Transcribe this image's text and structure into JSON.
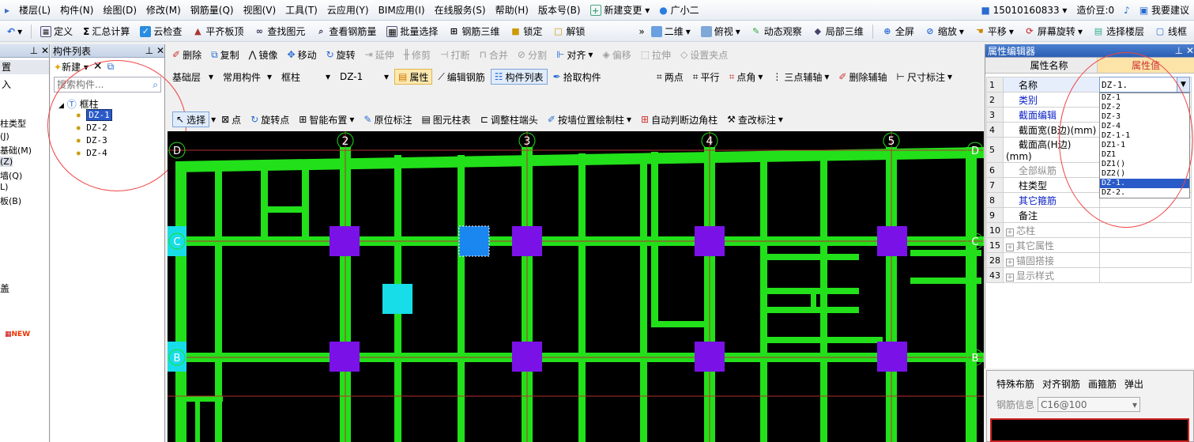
{
  "menu": [
    "楼层(L)",
    "构件(N)",
    "绘图(D)",
    "修改(M)",
    "钢筋量(Q)",
    "视图(V)",
    "工具(T)",
    "云应用(Y)",
    "BIM应用(I)",
    "在线服务(S)",
    "帮助(H)",
    "版本号(B)",
    "新建变更",
    "广小二"
  ],
  "account": {
    "phone": "15010160833",
    "coins": "造价豆:0",
    "suggest": "我要建议"
  },
  "toolbar1": {
    "define": "定义",
    "sum": "汇总计算",
    "cloudcheck": "云检查",
    "flat": "平齐板顶",
    "find": "查找图元",
    "viewrebar": "查看钢筋量",
    "batch": "批量选择",
    "rebar3d": "钢筋三维",
    "lock": "锁定",
    "unlock": "解锁",
    "view2d": "二维",
    "overlook": "俯视",
    "dynamic": "动态观察",
    "local3d": "局部三维",
    "fullscreen": "全屏",
    "zoom": "缩放",
    "pan": "平移",
    "rotate": "屏幕旋转",
    "selfloor": "选择楼层",
    "wire": "线框"
  },
  "edit_tb": {
    "delete": "删除",
    "copy": "复制",
    "mirror": "镜像",
    "move": "移动",
    "rotate": "旋转",
    "extend": "延伸",
    "trim": "修剪",
    "break": "打断",
    "merge": "合并",
    "split": "分割",
    "align": "对齐",
    "offset": "偏移",
    "stretch": "拉伸",
    "setpoint": "设置夹点"
  },
  "layer_tb": {
    "layer": "基础层",
    "common": "常用构件",
    "type": "框柱",
    "item": "DZ-1",
    "attr": "属性",
    "editrebar": "编辑钢筋",
    "complist": "构件列表",
    "pick": "拾取构件"
  },
  "axis_tb": {
    "twopoint": "两点",
    "parallel": "平行",
    "pointangle": "点角",
    "threeaxis": "三点辅轴",
    "delaxis": "删除辅轴",
    "dim": "尺寸标注"
  },
  "draw_tb": {
    "select": "选择",
    "point": "点",
    "rotpoint": "旋转点",
    "smart": "智能布置",
    "origin": "原位标注",
    "table": "图元柱表",
    "adjust": "调整柱端头",
    "bywall": "按墙位置绘制柱",
    "auto": "自动判断边角柱",
    "check": "查改标注"
  },
  "left_partial": [
    "置",
    "入",
    "柱类型",
    "(J)",
    "基础(M)",
    "(Z)",
    "墙(Q)",
    "L)",
    "板(B)",
    "盖"
  ],
  "complist": {
    "title": "构件列表",
    "new": "新建",
    "search_placeholder": "搜索构件...",
    "root": "框柱",
    "items": [
      "DZ-1",
      "DZ-2",
      "DZ-3",
      "DZ-4"
    ]
  },
  "axes": {
    "top": [
      "2",
      "3",
      "4",
      "5"
    ],
    "sides": [
      "D",
      "C",
      "B"
    ]
  },
  "props": {
    "title": "属性编辑器",
    "col_name": "属性名称",
    "col_value": "属性值",
    "rows": [
      {
        "n": "1",
        "name": "名称",
        "value": "DZ-1."
      },
      {
        "n": "2",
        "name": "类别",
        "value": ""
      },
      {
        "n": "3",
        "name": "截面编辑",
        "value": ""
      },
      {
        "n": "4",
        "name": "截面宽(B边)(mm)",
        "value": ""
      },
      {
        "n": "5",
        "name": "截面高(H边)(mm)",
        "value": ""
      },
      {
        "n": "6",
        "name": "全部纵筋",
        "value": ""
      },
      {
        "n": "7",
        "name": "柱类型",
        "value": ""
      },
      {
        "n": "8",
        "name": "其它箍筋",
        "value": ""
      },
      {
        "n": "9",
        "name": "备注",
        "value": ""
      },
      {
        "n": "10",
        "name": "芯柱",
        "value": ""
      },
      {
        "n": "15",
        "name": "其它属性",
        "value": ""
      },
      {
        "n": "28",
        "name": "锚固搭接",
        "value": ""
      },
      {
        "n": "43",
        "name": "显示样式",
        "value": ""
      }
    ],
    "dropdown": [
      "DZ-1",
      "DZ-2",
      "DZ-3",
      "DZ-4",
      "DZ-1-1",
      "DZ1-1",
      "DZ1",
      "DZ1()",
      "DZ2()",
      "DZ-1.",
      "DZ-2."
    ]
  },
  "bottom_right": {
    "tabs": [
      "特殊布筋",
      "对齐钢筋",
      "画箍筋",
      "弹出"
    ],
    "label": "钢筋信息",
    "value": "C16@100"
  },
  "colors": {
    "bg": "#000000",
    "beam": "#22e01a",
    "column": "#7a12e8",
    "selected": "#1a86f0",
    "cyan": "#17dde8",
    "grid": "#b93030"
  }
}
